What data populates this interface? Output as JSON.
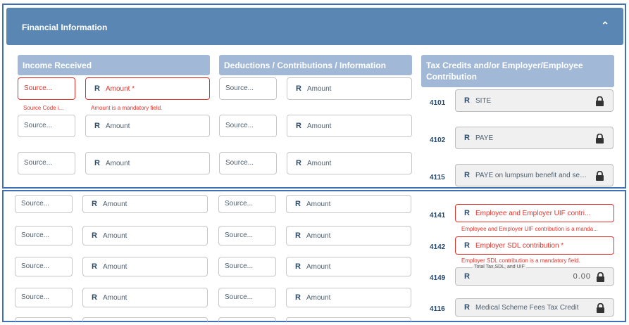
{
  "panel": {
    "title": "Financial Information",
    "collapse_icon": "chevron-up-icon"
  },
  "columns": {
    "income": "Income Received",
    "deductions": "Deductions / Contributions / Information",
    "credits": "Tax Credits and/or Employer/Employee Contribution"
  },
  "source_placeholder": "Source...",
  "amount_placeholder": "Amount",
  "currency_symbol": "R",
  "income_first_row": {
    "amount_label": "Amount *",
    "source_error": "Source Code i...",
    "amount_error": "Amount is a mandatory field."
  },
  "credits_top": [
    {
      "code": "4101",
      "label": "SITE"
    },
    {
      "code": "4102",
      "label": "PAYE"
    },
    {
      "code": "4115",
      "label": "PAYE on lumpsum benefit and seve..."
    }
  ],
  "credits_bottom": [
    {
      "code": "4141",
      "label": "Employee and Employer UIF contri...",
      "error": "Employee and Employer UIF contribution is a manda..."
    },
    {
      "code": "4142",
      "label": "Employer SDL contribution *",
      "error": "Employer SDL contribution is a mandatory field."
    },
    {
      "code": "4149",
      "floating_label": "Total Tax,SDL, and UIF",
      "value": "0.00"
    },
    {
      "code": "4116",
      "label": "Medical Scheme Fees Tax Credit"
    }
  ],
  "colors": {
    "header": "#5a86b4",
    "column_header": "#a1b9d6",
    "error": "#e2332b",
    "frame": "#3f6fb7"
  }
}
